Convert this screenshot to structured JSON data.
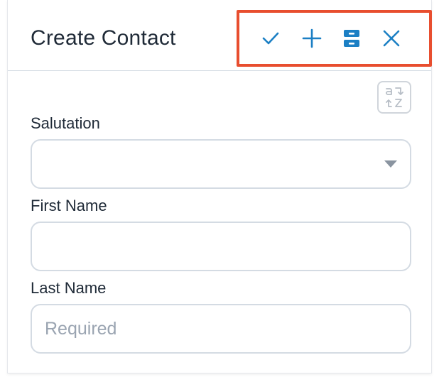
{
  "header": {
    "title": "Create Contact",
    "accent_color": "#1b7fc4",
    "highlight_color": "#e84e2f",
    "actions": [
      {
        "name": "save-check",
        "icon": "check-icon"
      },
      {
        "name": "save-and-new",
        "icon": "plus-icon"
      },
      {
        "name": "save-and-edit",
        "icon": "split-box-icon"
      },
      {
        "name": "cancel",
        "icon": "close-icon"
      }
    ]
  },
  "sort_button": {
    "icon": "sort-az-icon"
  },
  "form": {
    "salutation": {
      "label": "Salutation",
      "value": ""
    },
    "first_name": {
      "label": "First Name",
      "value": "",
      "placeholder": ""
    },
    "last_name": {
      "label": "Last Name",
      "value": "",
      "placeholder": "Required"
    }
  }
}
